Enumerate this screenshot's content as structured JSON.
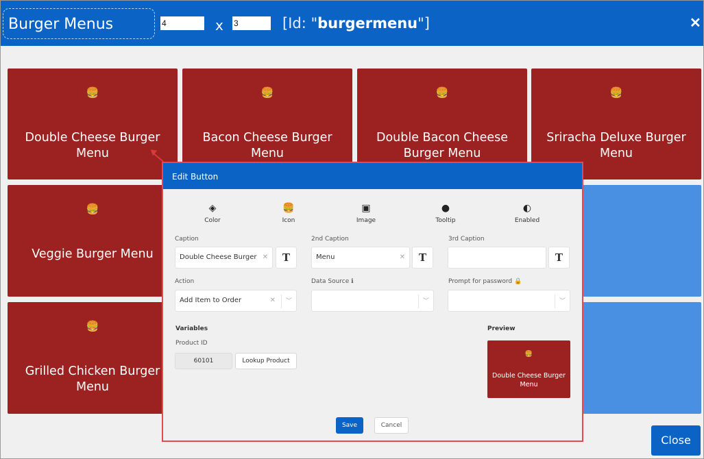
{
  "header": {
    "title": "Burger Menus",
    "columns": "4",
    "rows": "3",
    "x_label": "x",
    "id_prefix": "[Id: \"",
    "id_value": "burgermenu",
    "id_suffix": "\"]",
    "close_glyph": "✕"
  },
  "tiles": [
    {
      "label": "Double Cheese Burger Menu",
      "icon": "burger-fries-icon"
    },
    {
      "label": "Bacon Cheese Burger Menu",
      "icon": "burger-fries-icon"
    },
    {
      "label": "Double Bacon Cheese Burger Menu",
      "icon": "burger-fries-icon"
    },
    {
      "label": "Sriracha Deluxe Burger Menu",
      "icon": "burger-fries-icon"
    },
    {
      "label": "Veggie Burger Menu",
      "icon": "burger-fries-icon"
    },
    {
      "label": "Grilled Chicken Burger Menu",
      "icon": "burger-fries-icon"
    }
  ],
  "icon_glyph": "🍔",
  "dialog": {
    "title": "Edit Button",
    "tools": [
      {
        "label": "Color",
        "icon": "paint-bucket-icon",
        "glyph": "◈"
      },
      {
        "label": "Icon",
        "icon": "burger-fries-icon",
        "glyph": "🍔"
      },
      {
        "label": "Image",
        "icon": "image-icon",
        "glyph": "▣"
      },
      {
        "label": "Tooltip",
        "icon": "speech-bubble-icon",
        "glyph": "●"
      },
      {
        "label": "Enabled",
        "icon": "toggle-icon",
        "glyph": "◐"
      }
    ],
    "caption_label": "Caption",
    "caption_value": "Double Cheese Burger",
    "caption2_label": "2nd Caption",
    "caption2_value": "Menu",
    "caption3_label": "3rd Caption",
    "caption3_value": "",
    "format_glyph": "T",
    "clear_glyph": "✕",
    "caret_glyph": "﹀",
    "action_label": "Action",
    "action_value": "Add Item to Order",
    "datasource_label": "Data Source",
    "datasource_value": "",
    "password_label": "Prompt for password",
    "info_glyph": "ℹ",
    "lock_glyph": "🔒",
    "variables_label": "Variables",
    "product_id_label": "Product ID",
    "product_id_value": "60101",
    "lookup_label": "Lookup Product",
    "preview_label": "Preview",
    "preview_text": "Double Cheese Burger Menu",
    "save_label": "Save",
    "cancel_label": "Cancel"
  },
  "footer": {
    "close_label": "Close"
  },
  "colors": {
    "header_blue": "#0c63c6",
    "tile_red": "#9b2220",
    "tile_blue": "#4a90e2",
    "dialog_border": "#e8474f"
  }
}
